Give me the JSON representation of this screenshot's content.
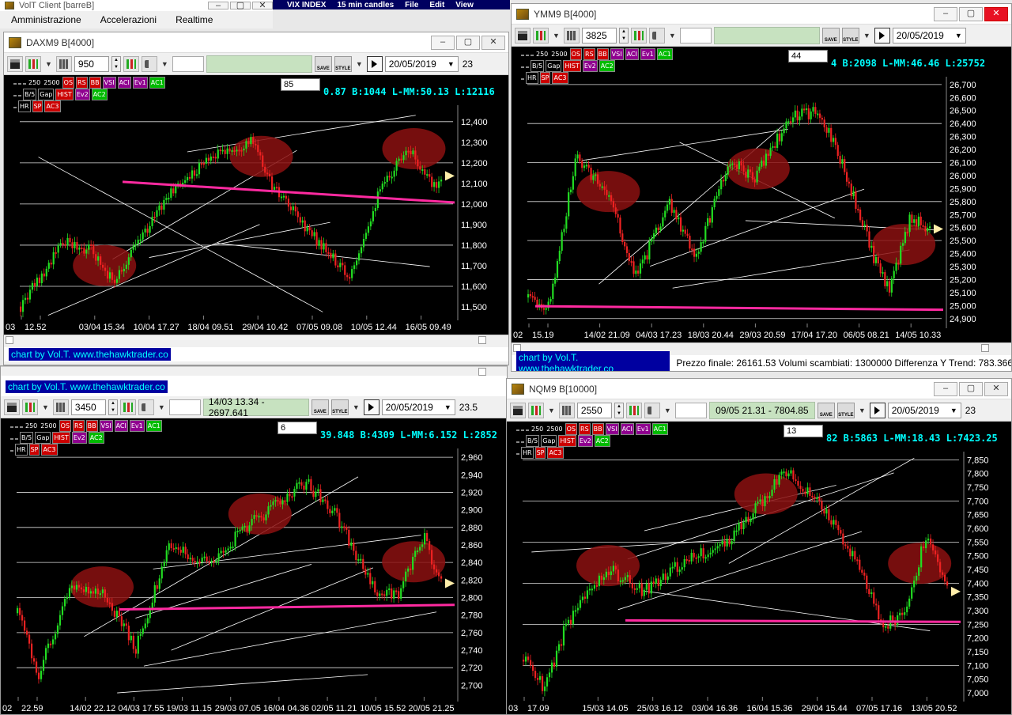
{
  "app": {
    "title": "VolT Client [barreB]",
    "menu": [
      "Amministrazione",
      "Accelerazioni",
      "Realtime"
    ],
    "strip": [
      "VIX INDEX",
      "15 min candles",
      "File",
      "Edit",
      "View"
    ]
  },
  "colors": {
    "up": "#22dd22",
    "down": "#ee2222",
    "trend": "#ff2aa0",
    "highlight": "#8b1010"
  },
  "windows": [
    {
      "id": "daxm9",
      "title": "DAXM9 B[4000]",
      "spin": "950",
      "green": "",
      "date": "20/05/2019",
      "time": "23",
      "box": "85",
      "ticker": "0.87 B:1044 L-MM:50.13 L:12116",
      "yticks": [
        "12,400",
        "12,300",
        "12,200",
        "12,100",
        "12,000",
        "11,900",
        "11,800",
        "11,700",
        "11,600",
        "11,500"
      ],
      "xticks": [
        "03",
        "12.52",
        "03/04 15.34",
        "10/04 17.27",
        "18/04 09.51",
        "29/04 10.42",
        "07/05 09.08",
        "10/05 12.44",
        "16/05 09.49"
      ],
      "credit": "chart by Vol.T. www.thehawktrader.co",
      "bottom": ""
    },
    {
      "id": "ymm9",
      "title": "YMM9 B[4000]",
      "spin": "3825",
      "green": "",
      "date": "20/05/2019",
      "time": "",
      "box": "44",
      "ticker": "4 B:2098 L-MM:46.46 L:25752",
      "yticks": [
        "26,700",
        "26,600",
        "26,500",
        "26,400",
        "26,300",
        "26,200",
        "26,100",
        "26,000",
        "25,900",
        "25,800",
        "25,700",
        "25,600",
        "25,500",
        "25,400",
        "25,300",
        "25,200",
        "25,100",
        "25,000",
        "24,900"
      ],
      "xticks": [
        "02",
        "15.19",
        "14/02 21.09",
        "04/03 17.23",
        "18/03 20.44",
        "29/03 20.59",
        "17/04 17.20",
        "06/05 08.21",
        "14/05 10.33"
      ],
      "credit": "chart by Vol.T. www.thehawktrader.co",
      "bottom": "Prezzo finale: 26161.53 Volumi scambiati: 1300000 Differenza Y Trend: 783.366"
    },
    {
      "id": "es",
      "title": "",
      "spin": "3450",
      "green": "14/03 13.34 - 2697.641",
      "date": "20/05/2019",
      "time": "23.5",
      "box": "6",
      "ticker": "39.848 B:4309 L-MM:6.152 L:2852",
      "yticks": [
        "2,960",
        "2,940",
        "2,920",
        "2,900",
        "2,880",
        "2,860",
        "2,840",
        "2,820",
        "2,800",
        "2,780",
        "2,760",
        "2,740",
        "2,720",
        "2,700"
      ],
      "xticks": [
        "02",
        "22.59",
        "14/02 22.12",
        "04/03 17.55",
        "19/03 11.15",
        "29/03 07.05",
        "16/04 04.36",
        "02/05 11.21",
        "10/05 15.52",
        "20/05 21.25"
      ],
      "credit": "chart by Vol.T. www.thehawktrader.co",
      "bottom": ""
    },
    {
      "id": "nqm9",
      "title": "NQM9 B[10000]",
      "spin": "2550",
      "green": "09/05 21.31 - 7804.85",
      "date": "20/05/2019",
      "time": "23",
      "box": "13",
      "ticker": "82 B:5863 L-MM:18.43 L:7423.25",
      "yticks": [
        "7,850",
        "7,800",
        "7,750",
        "7,700",
        "7,650",
        "7,600",
        "7,550",
        "7,500",
        "7,450",
        "7,400",
        "7,350",
        "7,300",
        "7,250",
        "7,200",
        "7,150",
        "7,100",
        "7,050",
        "7,000"
      ],
      "xticks": [
        "03",
        "17.09",
        "15/03 14.05",
        "25/03 16.12",
        "03/04 16.36",
        "16/04 15.36",
        "29/04 15.44",
        "07/05 17.16",
        "13/05 20.52"
      ],
      "credit": "",
      "bottom": ""
    }
  ],
  "indicators": {
    "row1": [
      "250",
      "2500",
      "OS",
      "RS",
      "BB",
      "VSI",
      "ACI",
      "Ev1",
      "AC1"
    ],
    "row2": [
      "B/5",
      "Gap",
      "HIST",
      "Ev2",
      "AC2"
    ],
    "row3": [
      "HR",
      "SP",
      "SP",
      "AC3"
    ]
  }
}
